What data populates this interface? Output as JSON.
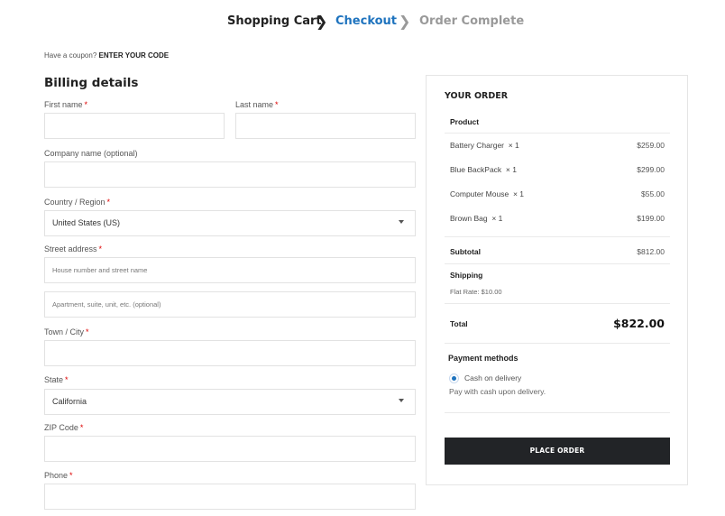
{
  "steps": {
    "cart": "Shopping Cart",
    "checkout": "Checkout",
    "complete": "Order Complete"
  },
  "coupon": {
    "prompt": "Have a coupon?",
    "link": "ENTER YOUR CODE"
  },
  "billing": {
    "title": "Billing details",
    "required_mark": "*",
    "first_name_label": "First name",
    "last_name_label": "Last name",
    "company_label": "Company name (optional)",
    "country_label": "Country / Region",
    "country_value": "United States (US)",
    "street_label": "Street address",
    "street_placeholder_1": "House number and street name",
    "street_placeholder_2": "Apartment, suite, unit, etc. (optional)",
    "city_label": "Town / City",
    "state_label": "State",
    "state_value": "California",
    "zip_label": "ZIP Code",
    "phone_label": "Phone"
  },
  "order": {
    "title": "YOUR ORDER",
    "product_header": "Product",
    "items": [
      {
        "name": "Battery Charger",
        "qty": "× 1",
        "price": "$259.00"
      },
      {
        "name": "Blue BackPack",
        "qty": "× 1",
        "price": "$299.00"
      },
      {
        "name": "Computer Mouse",
        "qty": "× 1",
        "price": "$55.00"
      },
      {
        "name": "Brown Bag",
        "qty": "× 1",
        "price": "$199.00"
      }
    ],
    "subtotal_label": "Subtotal",
    "subtotal_value": "$812.00",
    "shipping_label": "Shipping",
    "shipping_value": "Flat Rate: $10.00",
    "total_label": "Total",
    "total_value": "$822.00",
    "payment_title": "Payment methods",
    "payment_option": "Cash on delivery",
    "payment_desc": "Pay with cash upon delivery.",
    "place_order": "PLACE ORDER"
  },
  "colors": {
    "accent": "#1e73be",
    "required": "#dd0000",
    "button_bg": "#222427"
  },
  "icons": {
    "step_separator": "chevron-right-icon",
    "select_caret": "caret-down-icon",
    "payment_radio": "radio-selected-icon"
  }
}
